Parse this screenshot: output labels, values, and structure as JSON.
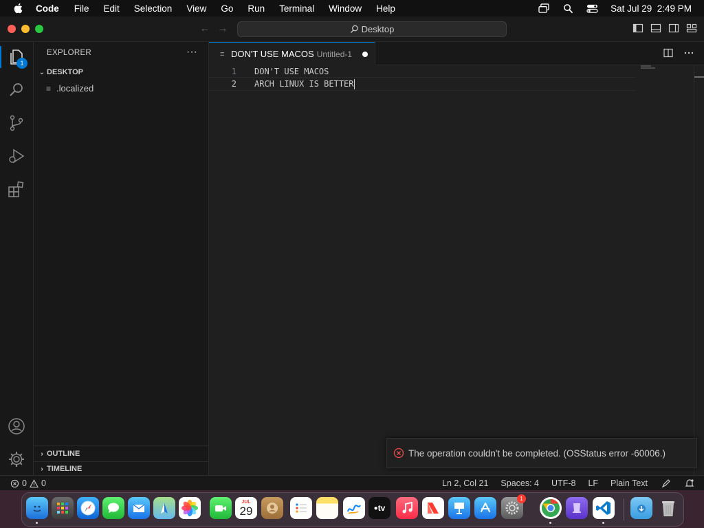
{
  "menubar": {
    "app": "Code",
    "items": [
      "File",
      "Edit",
      "Selection",
      "View",
      "Go",
      "Run",
      "Terminal",
      "Window",
      "Help"
    ],
    "clock": "Sat Jul 29  2:49 PM"
  },
  "titlebar": {
    "command_center": "Desktop"
  },
  "activitybar": {
    "explorer_badge": "1"
  },
  "sidebar": {
    "title": "EXPLORER",
    "folder": "DESKTOP",
    "files": [
      ".localized"
    ],
    "outline": "OUTLINE",
    "timeline": "TIMELINE"
  },
  "editor": {
    "tab_name": "DON'T USE MACOS",
    "tab_desc": "Untitled-1",
    "lines": [
      {
        "num": "1",
        "text": "DON'T USE MACOS"
      },
      {
        "num": "2",
        "text": "ARCH LINUX IS BETTER"
      }
    ]
  },
  "notification": {
    "message": "The operation couldn't be completed. (OSStatus error -60006.)"
  },
  "statusbar": {
    "errors": "0",
    "warnings": "0",
    "position": "Ln 2, Col 21",
    "spaces": "Spaces: 4",
    "encoding": "UTF-8",
    "eol": "LF",
    "language": "Plain Text"
  },
  "dock": {
    "calendar_month": "JUL",
    "calendar_day": "29",
    "settings_badge": "1",
    "tv_label": "tv"
  },
  "colors": {
    "accent": "#0078d4",
    "background": "#1f1f1f",
    "error": "#f14c4c"
  }
}
